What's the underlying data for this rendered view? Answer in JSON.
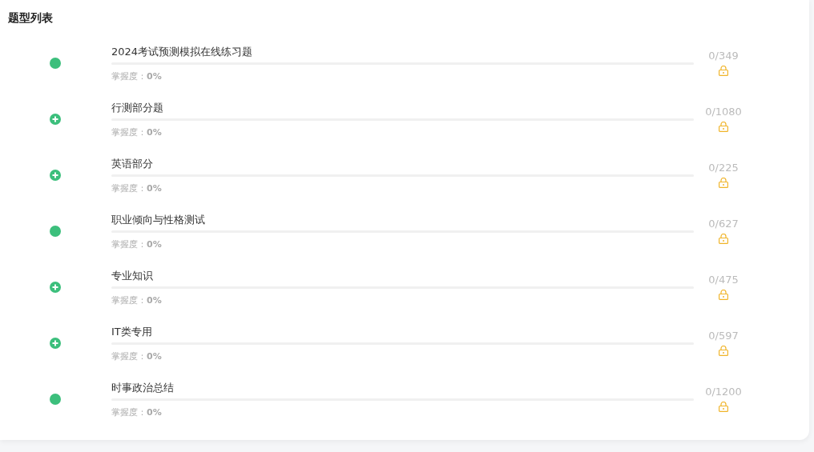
{
  "title": "题型列表",
  "items": [
    {
      "kind": "dot",
      "name": "2024考试预测模拟在线练习题",
      "mastery": "掌握度：**0%**",
      "count": "0/349",
      "locked": true
    },
    {
      "kind": "expand",
      "name": "行测部分题",
      "mastery": "掌握度：**0%**",
      "count": "0/1080",
      "locked": true
    },
    {
      "kind": "expand",
      "name": "英语部分",
      "mastery": "掌握度：**0%**",
      "count": "0/225",
      "locked": true
    },
    {
      "kind": "dot",
      "name": "职业倾向与性格测试",
      "mastery": "掌握度：**0%**",
      "count": "0/627",
      "locked": true
    },
    {
      "kind": "expand",
      "name": "专业知识",
      "mastery": "掌握度：**0%**",
      "count": "0/475",
      "locked": true
    },
    {
      "kind": "expand",
      "name": "IT类专用",
      "mastery": "掌握度：**0%**",
      "count": "0/597",
      "locked": true
    },
    {
      "kind": "dot",
      "name": "时事政治总结",
      "mastery": "掌握度：**0%**",
      "count": "0/1200",
      "locked": true
    }
  ]
}
